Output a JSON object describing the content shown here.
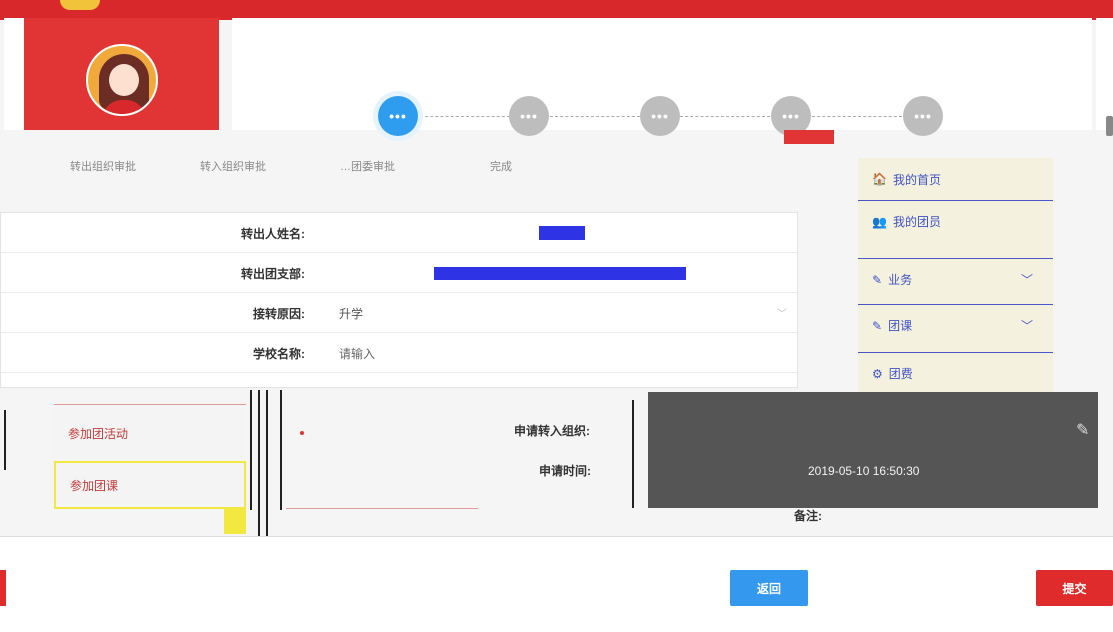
{
  "steps": [
    "转出组织审批",
    "转入组织审批",
    "…团委审批",
    "…团委审批",
    "完成"
  ],
  "step_icon_text": "•••",
  "nav": [
    {
      "icon": "🏠",
      "label": "我的首页"
    },
    {
      "icon": "👥",
      "label": "我的团员"
    },
    {
      "icon": "✎",
      "label": "业务"
    },
    {
      "icon": "✎",
      "label": "团课"
    },
    {
      "icon": "⚙",
      "label": "团费"
    }
  ],
  "form": {
    "name_label": "转出人姓名:",
    "branch_label": "转出团支部:",
    "reason_label": "接转原因:",
    "reason_value": "升学",
    "school_label": "学校名称:",
    "school_placeholder": "请输入",
    "apply_org_label": "申请转入组织:",
    "apply_time_label": "申请时间:",
    "apply_time_value": "2019-05-10 16:50:30",
    "remark_label": "备注:"
  },
  "left_menu": [
    {
      "label": "参加团活动"
    },
    {
      "label": "参加团课"
    }
  ],
  "buttons": {
    "back": "返回",
    "submit": "提交"
  },
  "colors": {
    "brand_red": "#e03534",
    "primary_blue": "#3398ee",
    "nav_bg": "#f4f1df",
    "mask_blue": "#2e33e6"
  }
}
